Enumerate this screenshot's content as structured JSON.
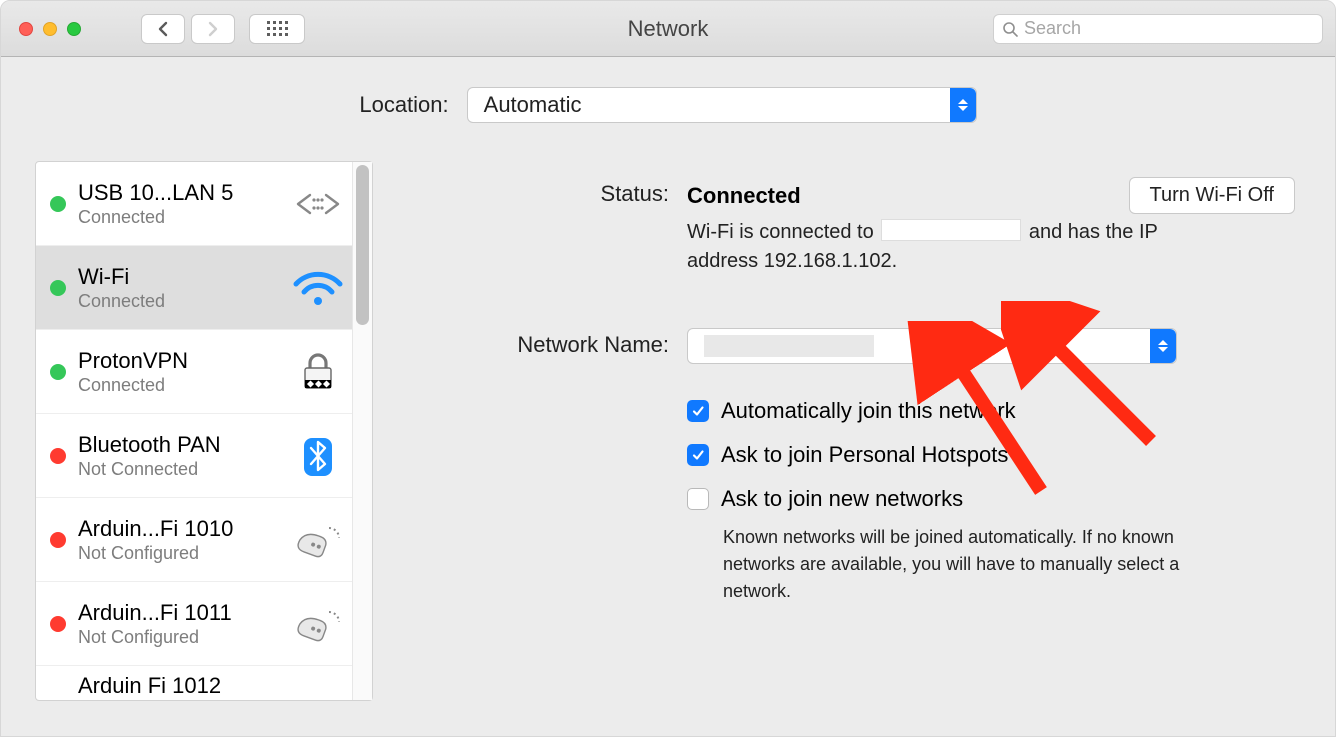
{
  "window": {
    "title": "Network"
  },
  "search": {
    "placeholder": "Search"
  },
  "location": {
    "label": "Location:",
    "value": "Automatic"
  },
  "sidebar": {
    "items": [
      {
        "name": "USB 10...LAN 5",
        "status": "Connected",
        "dot": "green",
        "icon": "ethernet"
      },
      {
        "name": "Wi-Fi",
        "status": "Connected",
        "dot": "green",
        "icon": "wifi",
        "selected": true
      },
      {
        "name": "ProtonVPN",
        "status": "Connected",
        "dot": "green",
        "icon": "vpn-lock"
      },
      {
        "name": "Bluetooth PAN",
        "status": "Not Connected",
        "dot": "red",
        "icon": "bluetooth"
      },
      {
        "name": "Arduin...Fi 1010",
        "status": "Not Configured",
        "dot": "red",
        "icon": "modem"
      },
      {
        "name": "Arduin...Fi 1011",
        "status": "Not Configured",
        "dot": "red",
        "icon": "modem"
      },
      {
        "name": "Arduin   Fi 1012",
        "status": "",
        "dot": "",
        "icon": ""
      }
    ]
  },
  "detail": {
    "status_label": "Status:",
    "status_value": "Connected",
    "wifi_button": "Turn Wi-Fi Off",
    "status_desc_pre": "Wi-Fi is connected to ",
    "status_desc_post": " and has the IP address 192.168.1.102.",
    "network_name_label": "Network Name:",
    "opt_auto_join": "Automatically join this network",
    "opt_ask_hotspot": "Ask to join Personal Hotspots",
    "opt_ask_new": "Ask to join new networks",
    "help_text": "Known networks will be joined automatically. If no known networks are available, you will have to manually select a network."
  }
}
